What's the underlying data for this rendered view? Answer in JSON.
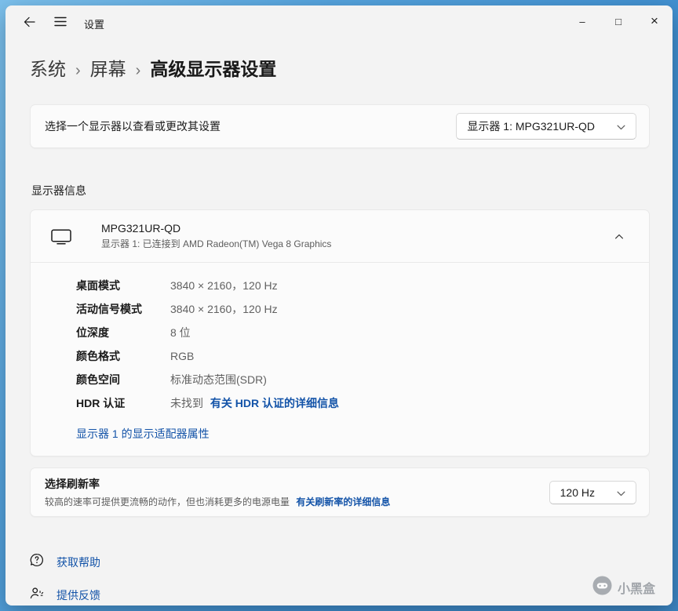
{
  "colors": {
    "accent_link": "#1353a8"
  },
  "titlebar": {
    "title": "设置",
    "minimize_glyph": "–",
    "maximize_glyph": "□",
    "close_glyph": "×"
  },
  "breadcrumb": {
    "separator": "›",
    "items": [
      "系统",
      "屏幕",
      "高级显示器设置"
    ]
  },
  "monitor_select": {
    "label": "选择一个显示器以查看或更改其设置",
    "value": "显示器 1: MPG321UR-QD"
  },
  "display_info": {
    "section_title": "显示器信息",
    "name": "MPG321UR-QD",
    "connection": "显示器 1: 已连接到 AMD Radeon(TM) Vega 8 Graphics",
    "details": [
      {
        "label": "桌面模式",
        "value": "3840 × 2160，120 Hz"
      },
      {
        "label": "活动信号模式",
        "value": "3840 × 2160，120 Hz"
      },
      {
        "label": "位深度",
        "value": "8 位"
      },
      {
        "label": "颜色格式",
        "value": "RGB"
      },
      {
        "label": "颜色空间",
        "value": "标准动态范围(SDR)"
      },
      {
        "label": "HDR 认证",
        "value": "未找到",
        "link": "有关 HDR 认证的详细信息"
      }
    ],
    "adapter_link": "显示器 1 的显示适配器属性"
  },
  "refresh_rate": {
    "title": "选择刷新率",
    "description": "较高的速率可提供更流畅的动作，但也消耗更多的电源电量",
    "link": "有关刷新率的详细信息",
    "value": "120 Hz"
  },
  "footer": {
    "get_help": "获取帮助",
    "feedback": "提供反馈"
  },
  "watermark": {
    "text": "小黑盒"
  }
}
